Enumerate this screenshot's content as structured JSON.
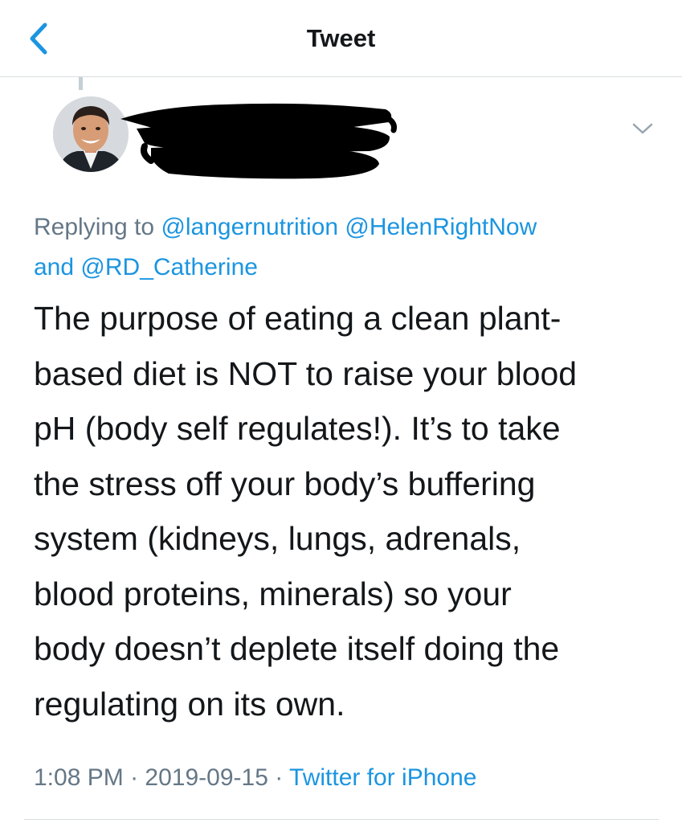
{
  "header": {
    "title": "Tweet",
    "back_icon": "chevron-left-icon",
    "accent_color": "#1b95e0"
  },
  "tweet": {
    "author": {
      "name_redacted": true,
      "avatar": "profile-photo"
    },
    "menu_icon": "chevron-down-icon",
    "replying_to": {
      "prefix": "Replying to",
      "mentions": [
        "@langernutrition",
        "@HelenRightNow",
        "@RD_Catherine"
      ],
      "conjunction": "and"
    },
    "text_lines": [
      "The purpose of eating a clean plant-",
      "based diet is NOT to raise your blood",
      "pH (body self regulates!). It’s to take",
      "the stress off your body’s buffering",
      "system (kidneys, lungs, adrenals,",
      "blood proteins, minerals) so your",
      "body doesn’t deplete itself doing the",
      "regulating on its own."
    ],
    "meta": {
      "time": "1:08 PM",
      "date": "2019-09-15",
      "separator": "·",
      "source": "Twitter for iPhone"
    }
  }
}
